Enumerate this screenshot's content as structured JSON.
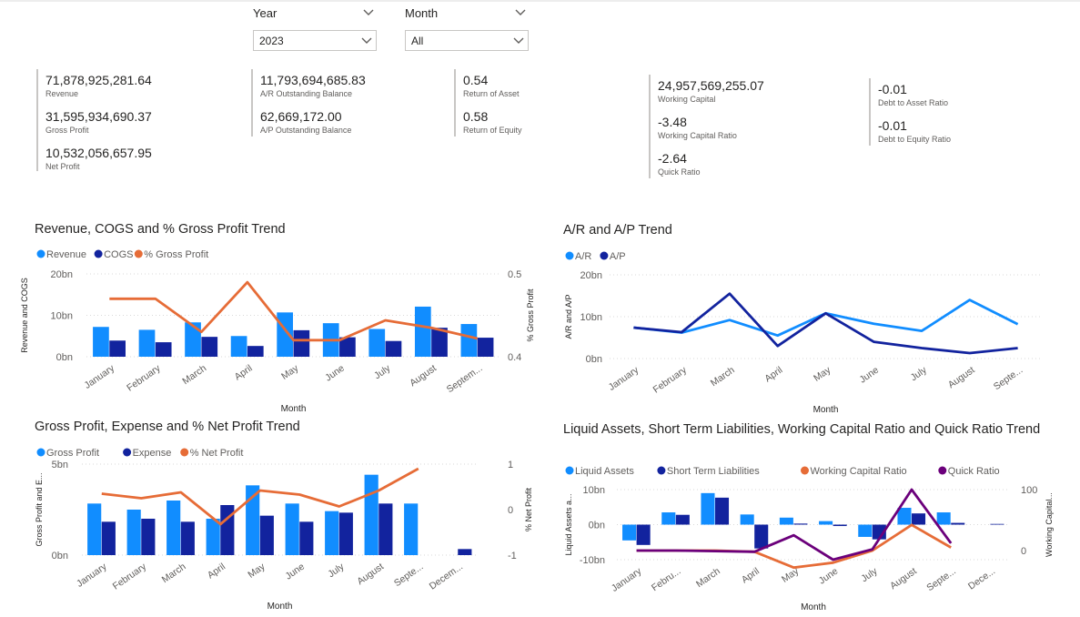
{
  "slicers": {
    "year": {
      "label": "Year",
      "value": "2023"
    },
    "month": {
      "label": "Month",
      "value": "All"
    }
  },
  "kpis": {
    "group1": [
      {
        "value": "71,878,925,281.64",
        "label": "Revenue"
      },
      {
        "value": "31,595,934,690.37",
        "label": "Gross Profit"
      },
      {
        "value": "10,532,056,657.95",
        "label": "Net Profit"
      }
    ],
    "group2": [
      {
        "value": "11,793,694,685.83",
        "label": "A/R Outstanding Balance"
      },
      {
        "value": "62,669,172.00",
        "label": "A/P Outstanding Balance"
      }
    ],
    "group3": [
      {
        "value": "0.54",
        "label": "Return of Asset"
      },
      {
        "value": "0.58",
        "label": "Return of Equity"
      }
    ],
    "group4": [
      {
        "value": "24,957,569,255.07",
        "label": "Working Capital"
      },
      {
        "value": "-3.48",
        "label": "Working Capital Ratio"
      },
      {
        "value": "-2.64",
        "label": "Quick Ratio"
      }
    ],
    "group5": [
      {
        "value": "-0.01",
        "label": "Debt to Asset Ratio"
      },
      {
        "value": "-0.01",
        "label": "Debt to Equity Ratio"
      }
    ]
  },
  "colors": {
    "light_blue": "#118DFF",
    "dark_blue": "#12239E",
    "orange": "#E66C37",
    "purple": "#6B007B",
    "grid": "#d9d9d9",
    "axis_text": "#605e5c"
  },
  "chart_data": [
    {
      "type": "bar",
      "title": "Revenue, COGS and % Gross Profit Trend",
      "xlabel": "Month",
      "ylabel": "Revenue and COGS",
      "y2label": "% Gross Profit",
      "categories": [
        "January",
        "February",
        "March",
        "April",
        "May",
        "June",
        "July",
        "August",
        "Septem..."
      ],
      "ylim": [
        0,
        20
      ],
      "yticks": [
        "0bn",
        "10bn",
        "20bn"
      ],
      "y2lim": [
        0.4,
        0.5
      ],
      "y2ticks": [
        "0.4",
        "0.5"
      ],
      "series": [
        {
          "name": "Revenue",
          "kind": "bar",
          "axis": "y",
          "values": [
            7.2,
            6.5,
            8.3,
            5.0,
            10.7,
            8.1,
            6.7,
            12.1,
            7.9
          ]
        },
        {
          "name": "COGS",
          "kind": "bar",
          "axis": "y",
          "values": [
            3.9,
            3.5,
            4.8,
            2.6,
            6.4,
            4.7,
            3.8,
            7.0,
            4.6
          ]
        },
        {
          "name": "% Gross Profit",
          "kind": "line",
          "axis": "y2",
          "values": [
            0.47,
            0.47,
            0.43,
            0.49,
            0.42,
            0.42,
            0.444,
            0.435,
            0.422
          ]
        }
      ],
      "legend": "top-left"
    },
    {
      "type": "line",
      "title": "A/R and A/P Trend",
      "xlabel": "Month",
      "ylabel": "A/R and A/P",
      "categories": [
        "January",
        "February",
        "March",
        "April",
        "May",
        "June",
        "July",
        "August",
        "Septe..."
      ],
      "ylim": [
        0,
        20
      ],
      "yticks": [
        "0bn",
        "10bn",
        "20bn"
      ],
      "series": [
        {
          "name": "A/R",
          "kind": "line",
          "axis": "y",
          "values": [
            7.4,
            6.2,
            9.2,
            5.5,
            10.8,
            8.3,
            6.6,
            14.0,
            8.2
          ]
        },
        {
          "name": "A/P",
          "kind": "line",
          "axis": "y",
          "values": [
            7.4,
            6.3,
            15.5,
            3.0,
            10.8,
            4.0,
            2.5,
            1.3,
            2.5
          ]
        }
      ],
      "legend": "top-left"
    },
    {
      "type": "bar",
      "title": "Gross Profit, Expense and % Net Profit Trend",
      "xlabel": "Month",
      "ylabel": "Gross Profit and E...",
      "y2label": "% Net Profit",
      "categories": [
        "January",
        "February",
        "March",
        "April",
        "May",
        "June",
        "July",
        "August",
        "Septe...",
        "Decem..."
      ],
      "ylim": [
        0,
        6
      ],
      "yticks": [
        "0bn",
        "5bn"
      ],
      "y2lim": [
        -1,
        1
      ],
      "y2ticks": [
        "-1",
        "0",
        "1"
      ],
      "series": [
        {
          "name": "Gross Profit",
          "kind": "bar",
          "axis": "y",
          "values": [
            3.4,
            3.0,
            3.6,
            2.4,
            4.6,
            3.4,
            2.9,
            5.3,
            3.4,
            0
          ]
        },
        {
          "name": "Expense",
          "kind": "bar",
          "axis": "y",
          "values": [
            2.2,
            2.4,
            2.2,
            3.3,
            2.6,
            2.2,
            2.8,
            3.4,
            0,
            0.4
          ]
        },
        {
          "name": "% Net Profit",
          "kind": "line",
          "axis": "y2",
          "values": [
            0.35,
            0.25,
            0.38,
            -0.32,
            0.42,
            0.33,
            0.07,
            0.42,
            0.9,
            null
          ]
        }
      ],
      "legend": "top-left"
    },
    {
      "type": "bar",
      "title": "Liquid Assets, Short Term Liabilities, Working Capital Ratio and Quick Ratio Trend",
      "xlabel": "Month",
      "ylabel": "Liquid Assets a...",
      "y2label": "Working Capital...",
      "categories": [
        "January",
        "Febru...",
        "March",
        "April",
        "May",
        "June",
        "July",
        "August",
        "Septe...",
        "Dece..."
      ],
      "ylim": [
        -10,
        10
      ],
      "yticks": [
        "-10bn",
        "0bn",
        "10bn"
      ],
      "y2lim": [
        -15,
        100
      ],
      "y2ticks": [
        "0",
        "100"
      ],
      "series": [
        {
          "name": "Liquid Assets",
          "kind": "bar",
          "axis": "y",
          "values": [
            -4.5,
            3.5,
            9.0,
            2.9,
            2.0,
            1.0,
            -3.5,
            4.8,
            3.5,
            0
          ]
        },
        {
          "name": "Short Term Liabilities",
          "kind": "bar",
          "axis": "y",
          "values": [
            -5.8,
            2.8,
            7.7,
            -6.8,
            0.3,
            -0.4,
            -4.2,
            3.2,
            0.5,
            0.2
          ]
        },
        {
          "name": "Working Capital Ratio",
          "kind": "line",
          "axis": "y2",
          "values": [
            0,
            0,
            0,
            -2,
            -28,
            -20,
            0,
            42,
            5,
            null
          ]
        },
        {
          "name": "Quick Ratio",
          "kind": "line",
          "axis": "y2",
          "values": [
            0,
            0,
            -1,
            -2,
            25,
            -15,
            2,
            100,
            12,
            null
          ]
        }
      ],
      "legend": "top-left"
    }
  ]
}
